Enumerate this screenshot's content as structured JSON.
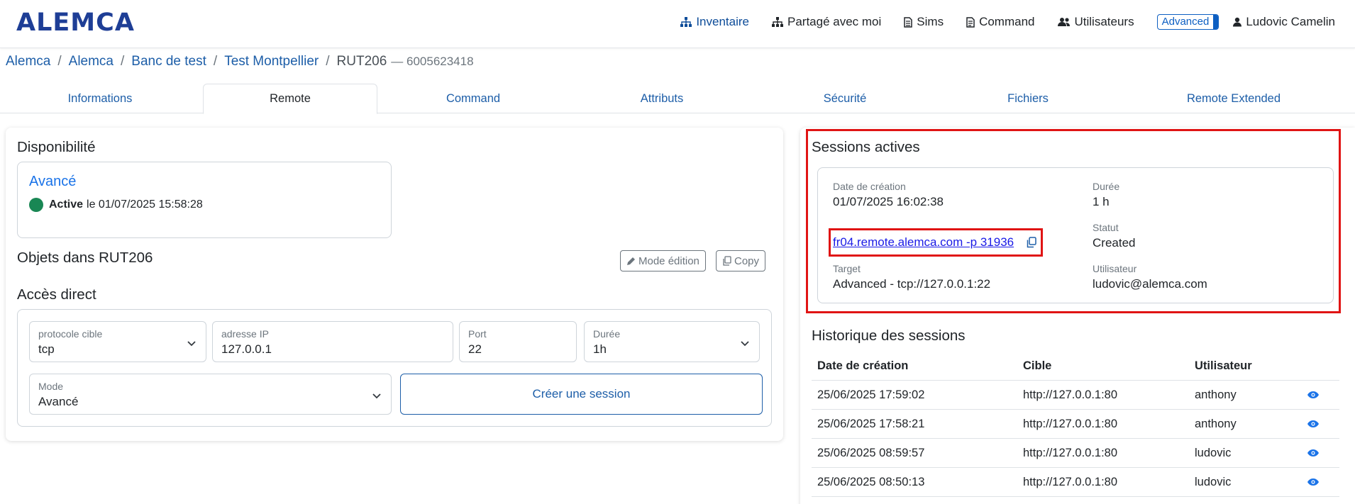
{
  "nav": {
    "logo": "ALEMCA",
    "items": [
      {
        "label": "Inventaire",
        "icon": "sitemap-icon"
      },
      {
        "label": "Partagé avec moi",
        "icon": "share-tree-icon"
      },
      {
        "label": "Sims",
        "icon": "sim-card-icon"
      },
      {
        "label": "Command",
        "icon": "document-icon"
      },
      {
        "label": "Utilisateurs",
        "icon": "users-icon"
      }
    ],
    "mode_badge": "Advanced",
    "user": "Ludovic Camelin"
  },
  "breadcrumb": {
    "items": [
      "Alemca",
      "Alemca",
      "Banc de test",
      "Test Montpellier"
    ],
    "current": "RUT206",
    "device_id": "— 6005623418"
  },
  "tabs": [
    "Informations",
    "Remote",
    "Command",
    "Attributs",
    "Sécurité",
    "Fichiers",
    "Remote Extended"
  ],
  "active_tab": "Remote",
  "left": {
    "availability_title": "Disponibilité",
    "availability": {
      "name": "Avancé",
      "status_bold": "Active",
      "status_rest": "le 01/07/2025 15:58:28",
      "status_color": "#198754"
    },
    "objects_title": "Objets dans RUT206",
    "edit_button": "Mode édition",
    "copy_button": "Copy",
    "direct_title": "Accès direct",
    "form": {
      "protocol_label": "protocole cible",
      "protocol_value": "tcp",
      "ip_label": "adresse IP",
      "ip_value": "127.0.0.1",
      "port_label": "Port",
      "port_value": "22",
      "duration_label": "Durée",
      "duration_value": "1h",
      "mode_label": "Mode",
      "mode_value": "Avancé",
      "create_button": "Créer une session"
    }
  },
  "right": {
    "active_title": "Sessions actives",
    "session": {
      "created_label": "Date de création",
      "created_value": "01/07/2025 16:02:38",
      "duration_label": "Durée",
      "duration_value": "1 h",
      "command": "fr04.remote.alemca.com -p 31936",
      "status_label": "Statut",
      "status_value": "Created",
      "target_label": "Target",
      "target_value": "Advanced - tcp://127.0.0.1:22",
      "user_label": "Utilisateur",
      "user_value": "ludovic@alemca.com"
    },
    "history_title": "Historique des sessions",
    "history_headers": [
      "Date de création",
      "Cible",
      "Utilisateur"
    ],
    "history_rows": [
      {
        "date": "25/06/2025 17:59:02",
        "target": "http://127.0.0.1:80",
        "user": "anthony"
      },
      {
        "date": "25/06/2025 17:58:21",
        "target": "http://127.0.0.1:80",
        "user": "anthony"
      },
      {
        "date": "25/06/2025 08:59:57",
        "target": "http://127.0.0.1:80",
        "user": "ludovic"
      },
      {
        "date": "25/06/2025 08:50:13",
        "target": "http://127.0.0.1:80",
        "user": "ludovic"
      }
    ]
  },
  "colors": {
    "brand": "#1e3e96",
    "link": "#1d5ea8",
    "highlight": "#e01414"
  }
}
